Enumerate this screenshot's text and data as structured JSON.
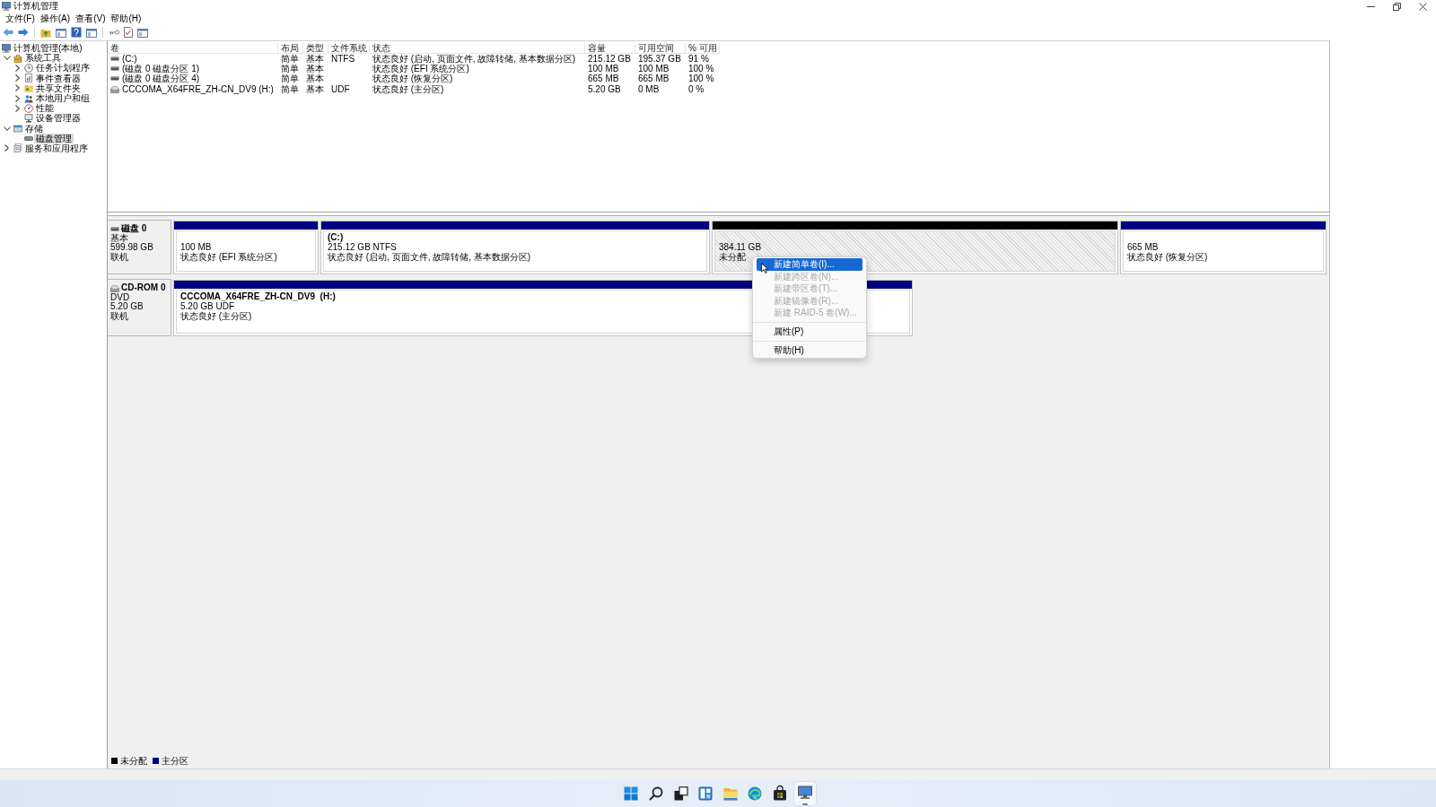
{
  "window": {
    "title": "计算机管理"
  },
  "menu": [
    "文件(F)",
    "操作(A)",
    "查看(V)",
    "帮助(H)"
  ],
  "tree": [
    {
      "label": "计算机管理(本地)",
      "kind": "computer",
      "expandable": false,
      "expanded": true,
      "selected": false,
      "children": [
        {
          "label": "系统工具",
          "kind": "tools",
          "expandable": true,
          "expanded": true,
          "selected": false,
          "children": [
            {
              "label": "任务计划程序",
              "kind": "clock",
              "expandable": true,
              "expanded": false,
              "selected": false
            },
            {
              "label": "事件查看器",
              "kind": "log",
              "expandable": true,
              "expanded": false,
              "selected": false
            },
            {
              "label": "共享文件夹",
              "kind": "share",
              "expandable": true,
              "expanded": false,
              "selected": false
            },
            {
              "label": "本地用户和组",
              "kind": "users",
              "expandable": true,
              "expanded": false,
              "selected": false
            },
            {
              "label": "性能",
              "kind": "gauge",
              "expandable": true,
              "expanded": false,
              "selected": false
            },
            {
              "label": "设备管理器",
              "kind": "device",
              "expandable": false,
              "selected": false
            }
          ]
        },
        {
          "label": "存储",
          "kind": "storage",
          "expandable": true,
          "expanded": true,
          "selected": false,
          "children": [
            {
              "label": "磁盘管理",
              "kind": "disk",
              "expandable": false,
              "selected": true
            }
          ]
        },
        {
          "label": "服务和应用程序",
          "kind": "services",
          "expandable": true,
          "expanded": false,
          "selected": false
        }
      ]
    }
  ],
  "volume_list": {
    "columns": [
      "卷",
      "布局",
      "类型",
      "文件系统",
      "状态",
      "容量",
      "可用空间",
      "% 可用"
    ],
    "rows": [
      {
        "kind": "drive",
        "volume": "(C:)",
        "layout": "简单",
        "type": "基本",
        "file_system": "NTFS",
        "status": "状态良好 (启动, 页面文件, 故障转储, 基本数据分区)",
        "capacity": "215.12 GB",
        "free_space": "195.37 GB",
        "percent_free": "91 %"
      },
      {
        "kind": "drive",
        "volume": "(磁盘 0 磁盘分区 1)",
        "layout": "简单",
        "type": "基本",
        "status": "状态良好 (EFI 系统分区)",
        "capacity": "100 MB",
        "free_space": "100 MB",
        "percent_free": "100 %"
      },
      {
        "kind": "drive",
        "volume": "(磁盘 0 磁盘分区 4)",
        "layout": "简单",
        "type": "基本",
        "status": "状态良好 (恢复分区)",
        "capacity": "665 MB",
        "free_space": "665 MB",
        "percent_free": "100 %"
      },
      {
        "kind": "optical",
        "volume": "CCCOMA_X64FRE_ZH-CN_DV9 (H:)",
        "layout": "简单",
        "type": "基本",
        "file_system": "UDF",
        "status": "状态良好 (主分区)",
        "capacity": "5.20 GB",
        "free_space": "0 MB",
        "percent_free": "0 %"
      }
    ]
  },
  "disks": [
    {
      "kind": "drive",
      "name": "磁盘 0",
      "type": "基本",
      "size": "599.98 GB",
      "state": "联机",
      "partitions": [
        {
          "kind": "primary",
          "size": "100 MB",
          "status": "状态良好 (EFI 系统分区)"
        },
        {
          "kind": "primary",
          "name": "(C:)",
          "size": "215.12 GB NTFS",
          "status": "状态良好 (启动, 页面文件, 故障转储, 基本数据分区)"
        },
        {
          "kind": "unallocated",
          "size": "384.11 GB",
          "status": "未分配"
        },
        {
          "kind": "primary",
          "size": "665 MB",
          "status": "状态良好 (恢复分区)"
        }
      ]
    },
    {
      "kind": "optical",
      "name": "CD-ROM 0",
      "type": "DVD",
      "size": "5.20 GB",
      "state": "联机",
      "partitions": [
        {
          "kind": "primary",
          "name": "CCCOMA_X64FRE_ZH-CN_DV9  (H:)",
          "size": "5.20 GB UDF",
          "status": "状态良好 (主分区)"
        }
      ]
    }
  ],
  "legend": [
    {
      "label": "未分配",
      "color": "#000000"
    },
    {
      "label": "主分区",
      "color": "#000080"
    }
  ],
  "context_menu": {
    "groups": [
      [
        {
          "label": "新建简单卷(I)...",
          "disabled": false,
          "selected": true
        },
        {
          "label": "新建跨区卷(N)...",
          "disabled": true,
          "selected": false
        },
        {
          "label": "新建带区卷(T)...",
          "disabled": true,
          "selected": false
        },
        {
          "label": "新建镜像卷(R)...",
          "disabled": true,
          "selected": false
        },
        {
          "label": "新建 RAID-5 卷(W)...",
          "disabled": true,
          "selected": false
        }
      ],
      [
        {
          "label": "属性(P)",
          "disabled": false,
          "selected": false
        }
      ],
      [
        {
          "label": "帮助(H)",
          "disabled": false,
          "selected": false
        }
      ]
    ]
  },
  "taskbar": {
    "items": [
      {
        "kind": "start",
        "active": false
      },
      {
        "kind": "search",
        "active": false
      },
      {
        "kind": "taskview",
        "active": false
      },
      {
        "kind": "widgets",
        "active": false
      },
      {
        "kind": "explorer",
        "active": false
      },
      {
        "kind": "browser",
        "active": false
      },
      {
        "kind": "store",
        "active": false
      },
      {
        "kind": "manager",
        "active": true
      }
    ]
  }
}
